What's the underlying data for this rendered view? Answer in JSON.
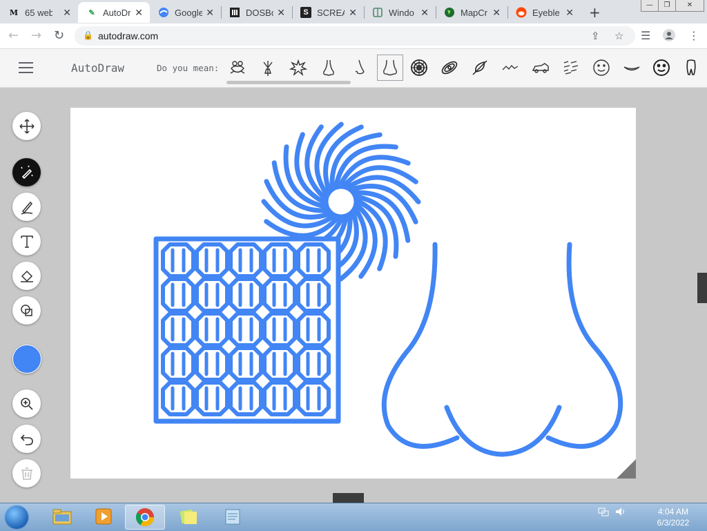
{
  "browser": {
    "tabs": [
      {
        "title": "65 web",
        "icon": "m-logo-icon",
        "active": false
      },
      {
        "title": "AutoDr",
        "icon": "autodraw-pen-icon",
        "active": true
      },
      {
        "title": "Google",
        "icon": "google-earth-icon",
        "active": false
      },
      {
        "title": "DOSBo",
        "icon": "museum-icon",
        "active": false
      },
      {
        "title": "SCREA",
        "icon": "s-logo-icon",
        "active": false
      },
      {
        "title": "Windo",
        "icon": "window-icon",
        "active": false
      },
      {
        "title": "MapCr",
        "icon": "globe-icon",
        "active": false
      },
      {
        "title": "Eyeble",
        "icon": "reddit-icon",
        "active": false
      }
    ],
    "url": "autodraw.com"
  },
  "app": {
    "brand": "AutoDraw",
    "prompt": "Do you mean:",
    "suggestions": [
      "frog-doodle-icon",
      "plant-doodle-icon",
      "splat-doodle-icon",
      "nose-doodle-icon",
      "nose-side-doodle-icon",
      "nose-front-doodle-icon",
      "spiral-sun-doodle-icon",
      "galaxy-doodle-icon",
      "feather-doodle-icon",
      "mountains-doodle-icon",
      "car-doodle-icon",
      "pattern-doodle-icon",
      "smiley-face-doodle-icon",
      "lips-doodle-icon",
      "smiley-face-outline-doodle-icon",
      "tooth-doodle-icon"
    ],
    "tools": [
      "move-icon",
      "autodraw-icon",
      "draw-icon",
      "text-icon",
      "fill-icon",
      "shape-icon",
      "zoom-icon",
      "undo-icon",
      "trash-icon"
    ],
    "current_color": "#4285f4",
    "stroke_color": "#4285f4"
  },
  "taskbar": {
    "items": [
      "explorer-icon",
      "media-player-icon",
      "chrome-icon",
      "sticky-notes-icon",
      "notepad-icon"
    ],
    "time": "4:04 AM",
    "date": "6/3/2022"
  }
}
